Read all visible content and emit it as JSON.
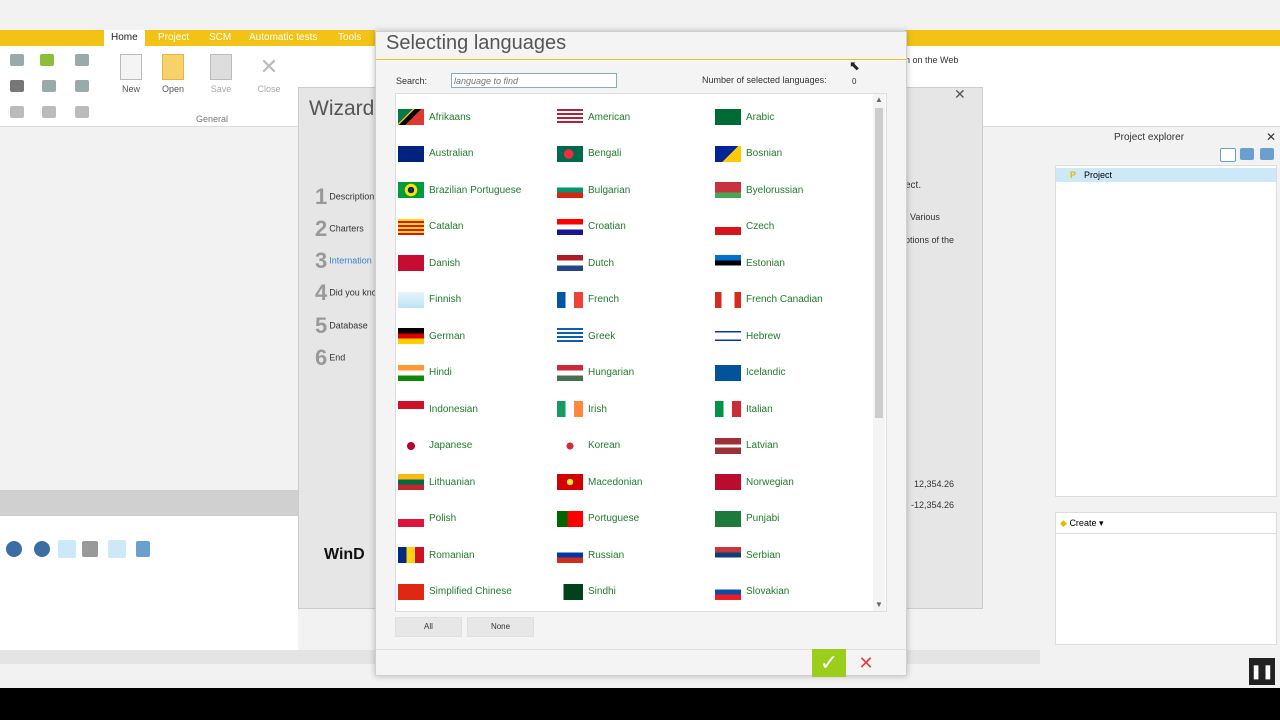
{
  "ribbon": {
    "tabs": [
      "Home",
      "Project",
      "SCM",
      "Automatic tests",
      "Tools"
    ],
    "buttons": {
      "new": "New",
      "open": "Open",
      "save": "Save",
      "close": "Close"
    },
    "group_label": "General",
    "right_text": "n on the Web"
  },
  "wizard": {
    "title": "Wizard",
    "steps": [
      {
        "num": "1",
        "label": "Description"
      },
      {
        "num": "2",
        "label": "Charters"
      },
      {
        "num": "3",
        "label": "Internation"
      },
      {
        "num": "4",
        "label": "Did you kno"
      },
      {
        "num": "5",
        "label": "Database"
      },
      {
        "num": "6",
        "label": "End"
      }
    ],
    "right_texts": {
      "ect": "ect.",
      "various": "Various",
      "options": "ptions of the",
      "val1": "12,354.26",
      "val2": "-12,354.26"
    },
    "logo_text": "WinD"
  },
  "project_explorer": {
    "title": "Project explorer",
    "item": "Project",
    "create_label": "Create"
  },
  "dialog": {
    "title": "Selecting languages",
    "search_label": "Search:",
    "search_placeholder": "language to find",
    "count_label": "Number of selected languages:",
    "count_value": "0",
    "all_label": "All",
    "none_label": "None",
    "ok_glyph": "✓",
    "cancel_glyph": "✕",
    "languages": [
      "Afrikaans",
      "American",
      "Arabic",
      "Australian",
      "Bengali",
      "Bosnian",
      "Brazilian Portuguese",
      "Bulgarian",
      "Byelorussian",
      "Catalan",
      "Croatian",
      "Czech",
      "Danish",
      "Dutch",
      "Estonian",
      "Finnish",
      "French",
      "French Canadian",
      "German",
      "Greek",
      "Hebrew",
      "Hindi",
      "Hungarian",
      "Icelandic",
      "Indonesian",
      "Irish",
      "Italian",
      "Japanese",
      "Korean",
      "Latvian",
      "Lithuanian",
      "Macedonian",
      "Norwegian",
      "Polish",
      "Portuguese",
      "Punjabi",
      "Romanian",
      "Russian",
      "Serbian",
      "Simplified Chinese",
      "Sindhi",
      "Slovakian"
    ]
  },
  "colors": {
    "accent": "#f2c315",
    "language_text": "#1f7d2c",
    "ok_button": "#9acd1c",
    "cancel_icon": "#e04040"
  }
}
